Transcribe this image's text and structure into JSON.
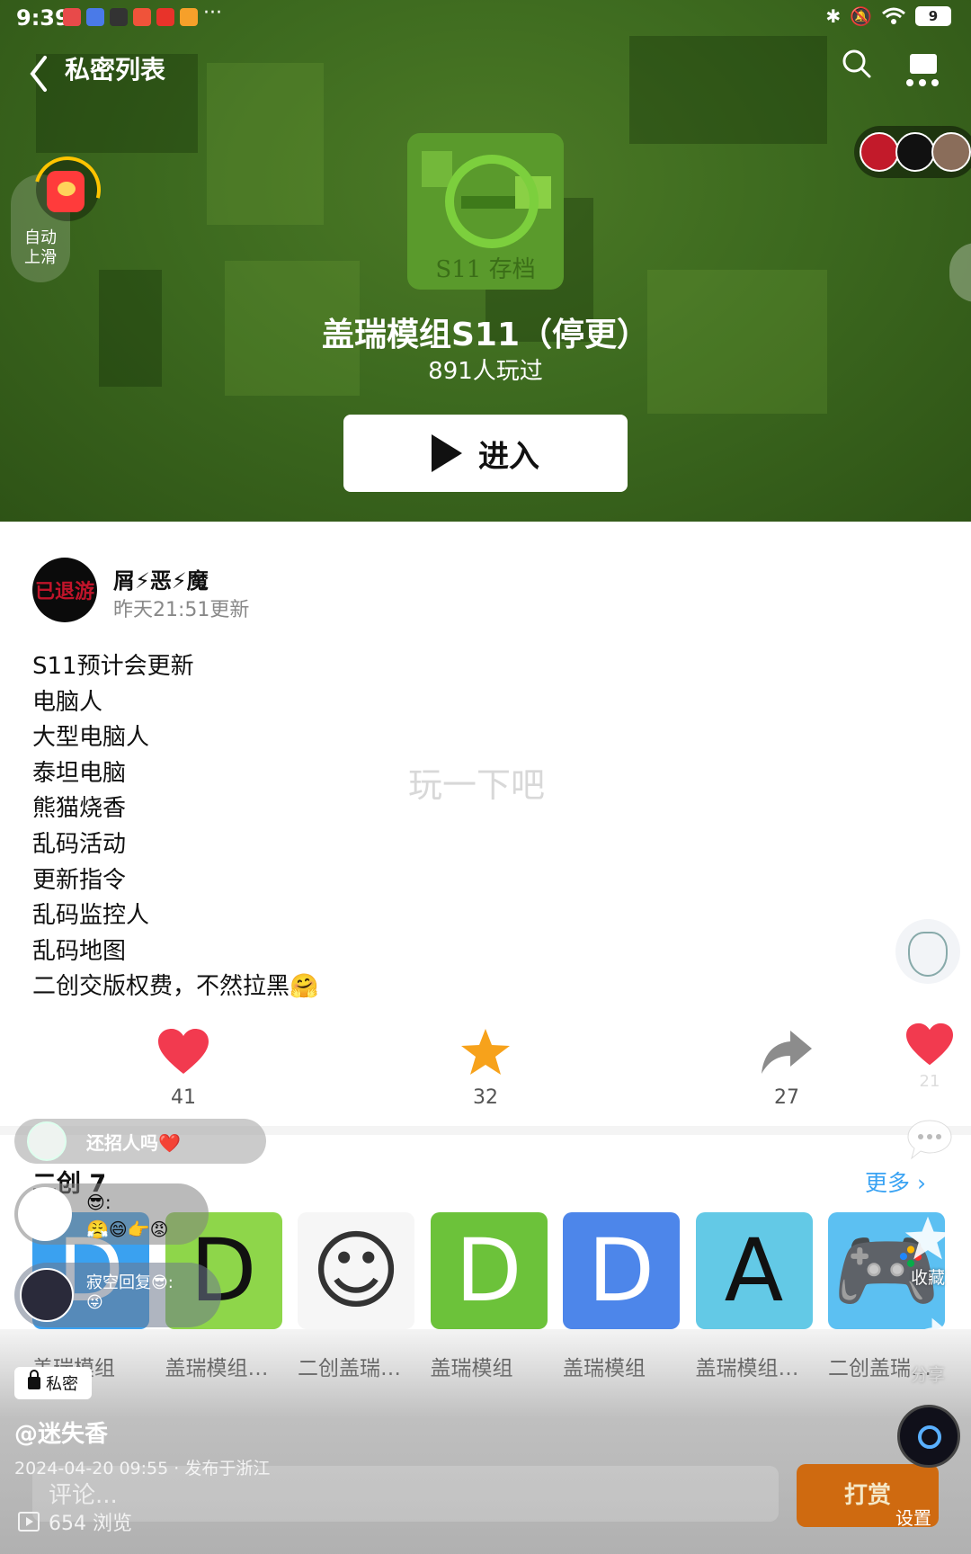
{
  "status_bar": {
    "time": "9:39",
    "battery": "9",
    "more": "···"
  },
  "nav": {
    "title": "私密列表"
  },
  "auto_scroll": {
    "line1": "自动",
    "line2": "上滑"
  },
  "game": {
    "title": "盖瑞模组S11（停更）",
    "players": "891人玩过",
    "enter_label": "进入",
    "cover_caption": "S11 存档"
  },
  "author": {
    "name": "屑⚡恶⚡魔",
    "updated": "昨天21:51更新",
    "avatar_text": "已退游"
  },
  "description_lines": [
    "S11预计会更新",
    "电脑人",
    "大型电脑人",
    "泰坦电脑",
    "熊猫烧香",
    "乱码活动",
    "更新指令",
    "乱码监控人",
    "乱码地图",
    "二创交版权费，不然拉黑🤗"
  ],
  "watermark": "玩一下吧",
  "stats": {
    "likes": "41",
    "favorites": "32",
    "shares": "27"
  },
  "side": {
    "likes": "21",
    "favorite_label": "收藏",
    "share_label": "分享",
    "settings_label": "设置"
  },
  "comment_float": {
    "text": "还招人吗❤️"
  },
  "reply_float": {
    "text": "寂空回复😎:",
    "emojis": "😎:",
    "emojis2": "😤😄👉😡",
    "emojis3": "😜"
  },
  "derivatives": {
    "heading": "二创 7",
    "more": "更多 ›",
    "items": [
      {
        "label": "盖瑞模组",
        "glyph": "D",
        "bg": "#3aa1f0",
        "fg": "#ffffff"
      },
      {
        "label": "盖瑞模组…",
        "glyph": "D",
        "bg": "#8ed64a",
        "fg": "#111111"
      },
      {
        "label": "二创盖瑞…",
        "glyph": "☺",
        "bg": "#f6f6f6",
        "fg": "#333333"
      },
      {
        "label": "盖瑞模组",
        "glyph": "D",
        "bg": "#6cc23a",
        "fg": "#ffffff"
      },
      {
        "label": "盖瑞模组",
        "glyph": "D",
        "bg": "#4d86ea",
        "fg": "#ffffff"
      },
      {
        "label": "盖瑞模组…",
        "glyph": "A",
        "bg": "#63c9e6",
        "fg": "#111111"
      },
      {
        "label": "二创盖瑞…",
        "glyph": "🎮",
        "bg": "#5cc0f2",
        "fg": "#ffffff"
      }
    ]
  },
  "private_chip": "私密",
  "poster": "@迷失香",
  "post_meta": "2024-04-20 09:55 · 发布于浙江",
  "comment_placeholder": "评论...",
  "views": "654 浏览",
  "tip_label": "打赏",
  "colors": {
    "accent_blue": "#3aa3f3",
    "heart_red": "#f23a4f",
    "star_orange": "#f7a21b",
    "tip_orange": "#cf6a10"
  }
}
